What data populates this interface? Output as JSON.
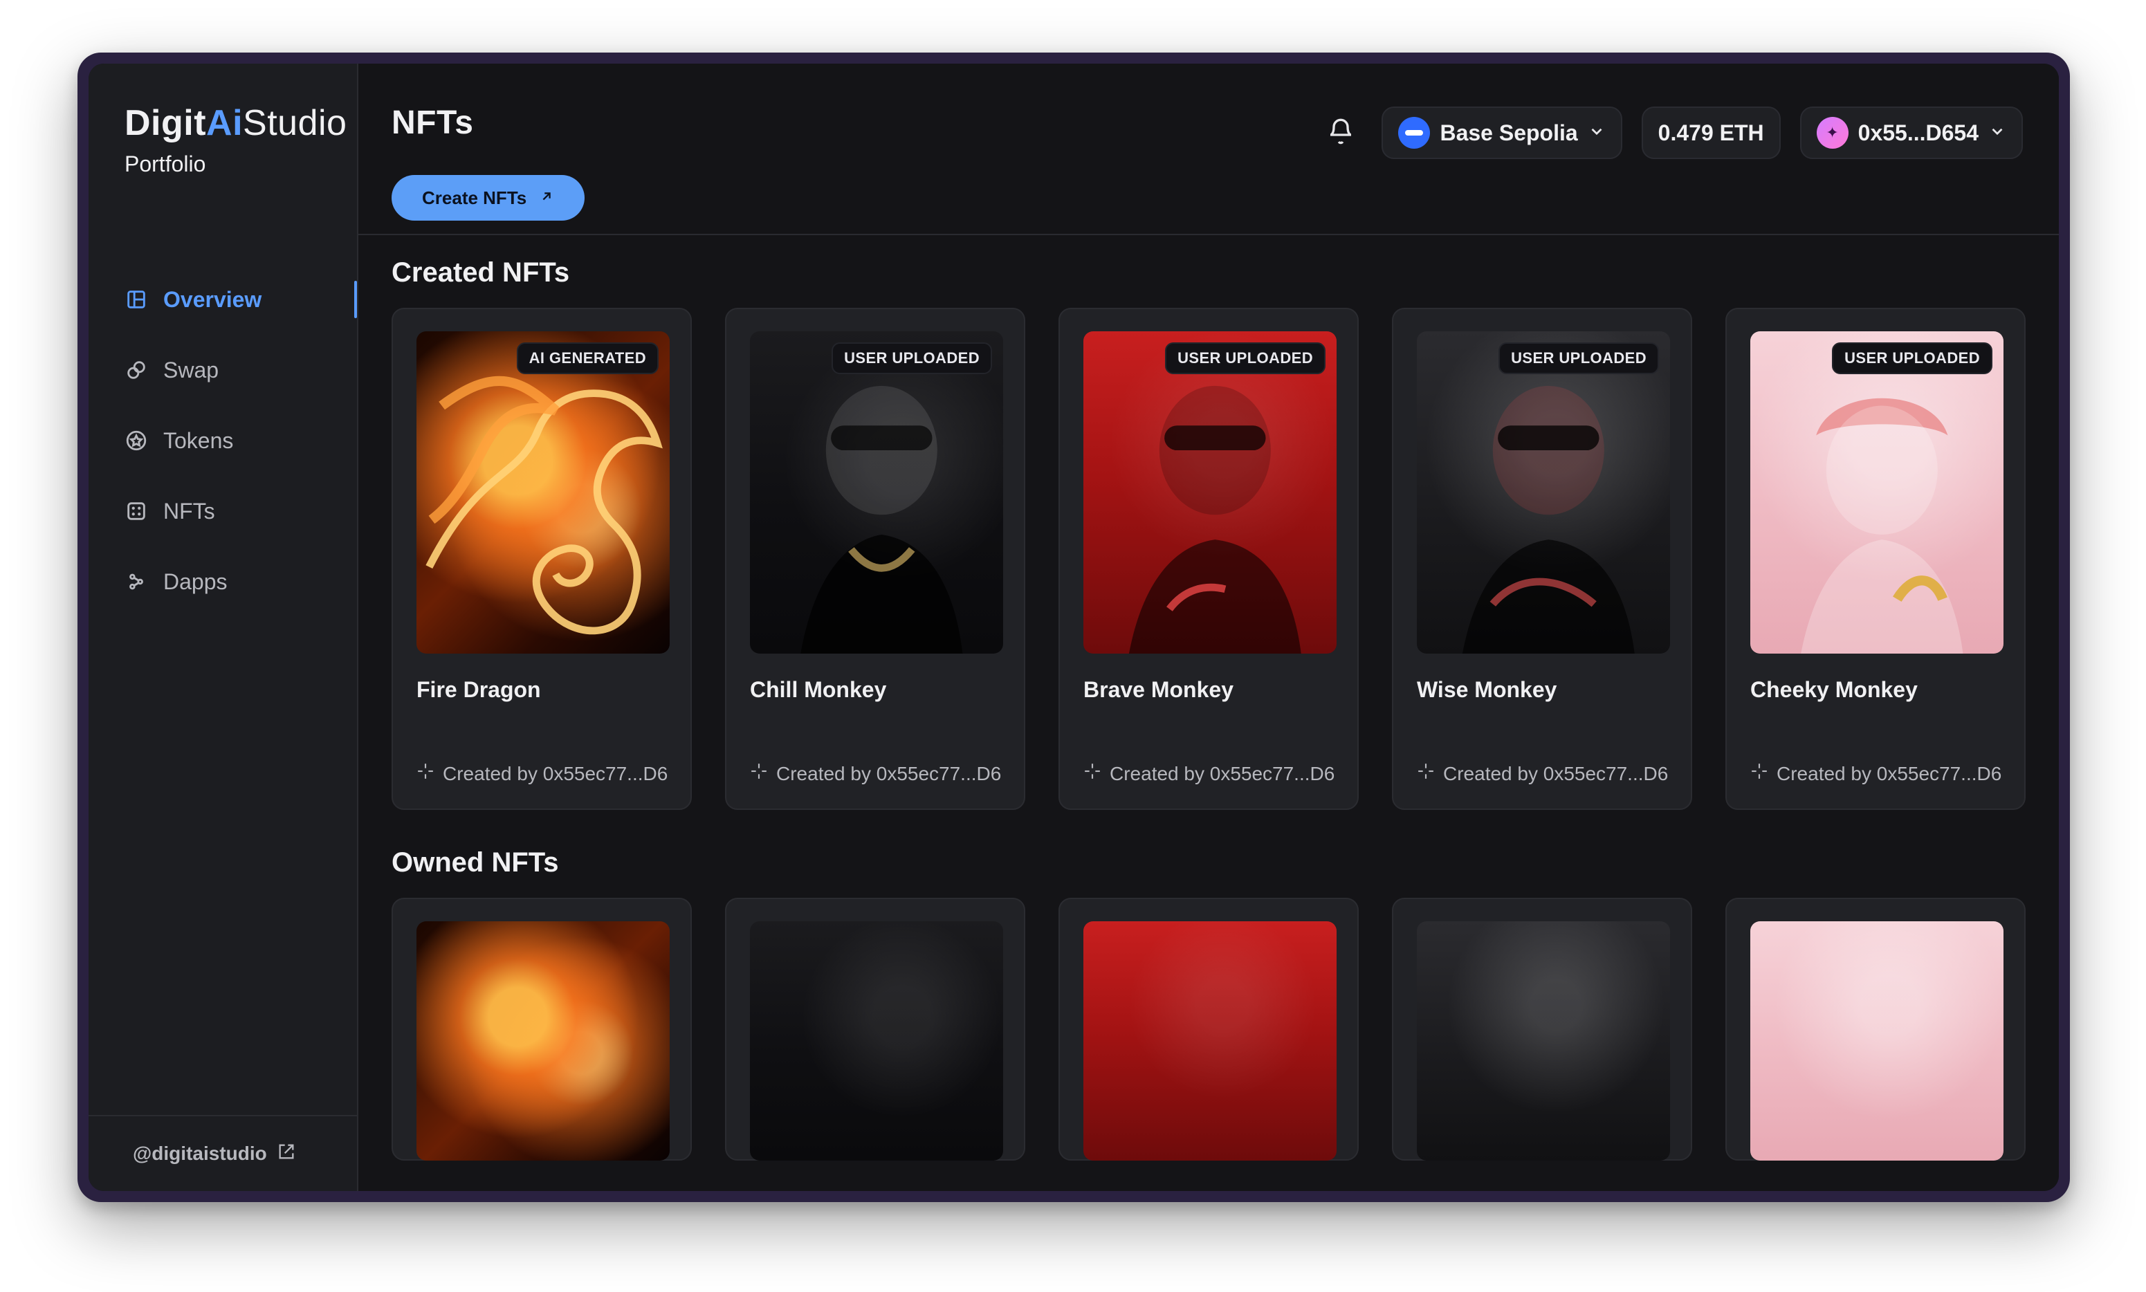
{
  "brand": {
    "logo_part1": "Digit",
    "logo_part2": "Ai",
    "logo_part3": "Studio",
    "subtitle": "Portfolio"
  },
  "sidebar": {
    "items": [
      {
        "label": "Overview",
        "active": true,
        "icon": "layout-icon"
      },
      {
        "label": "Swap",
        "active": false,
        "icon": "swap-icon"
      },
      {
        "label": "Tokens",
        "active": false,
        "icon": "tokens-icon"
      },
      {
        "label": "NFTs",
        "active": false,
        "icon": "nfts-icon"
      },
      {
        "label": "Dapps",
        "active": false,
        "icon": "dapps-icon"
      }
    ],
    "footer": {
      "handle": "@digitaistudio",
      "icon": "external-link-icon"
    }
  },
  "header": {
    "title": "NFTs",
    "create_button": "Create NFTs",
    "network": "Base Sepolia",
    "balance": "0.479 ETH",
    "account": "0x55...D654"
  },
  "sections": {
    "created_title": "Created NFTs",
    "owned_title": "Owned NFTs"
  },
  "created_nfts": [
    {
      "name": "Fire Dragon",
      "badge": "AI GENERATED",
      "creator": "Created by 0x55ec77...D6"
    },
    {
      "name": "Chill Monkey",
      "badge": "USER UPLOADED",
      "creator": "Created by 0x55ec77...D6"
    },
    {
      "name": "Brave Monkey",
      "badge": "USER UPLOADED",
      "creator": "Created by 0x55ec77...D6"
    },
    {
      "name": "Wise Monkey",
      "badge": "USER UPLOADED",
      "creator": "Created by 0x55ec77...D6"
    },
    {
      "name": "Cheeky Monkey",
      "badge": "USER UPLOADED",
      "creator": "Created by 0x55ec77...D6"
    }
  ],
  "colors": {
    "accent": "#5a9cff",
    "background": "#141417",
    "sidebar": "#1c1d21",
    "card": "#212226"
  }
}
